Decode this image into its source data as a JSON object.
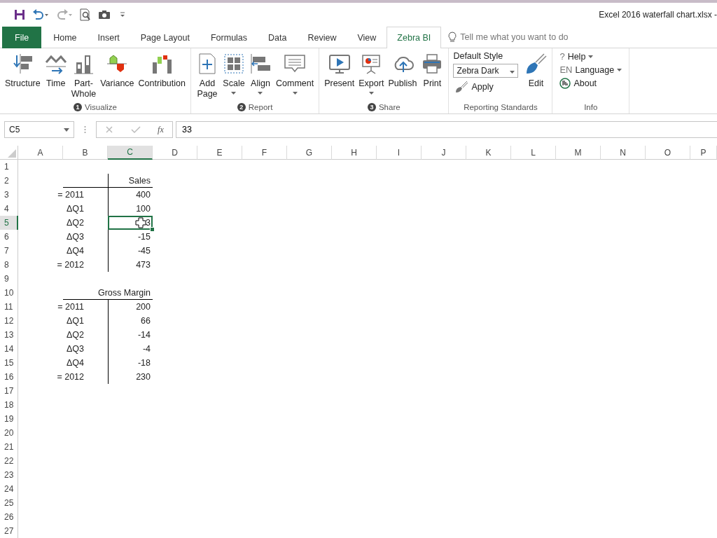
{
  "window": {
    "title": "Excel 2016 waterfall chart.xlsx -"
  },
  "tabs": [
    {
      "label": "File",
      "kind": "file",
      "selected": false
    },
    {
      "label": "Home",
      "kind": "tab",
      "selected": false
    },
    {
      "label": "Insert",
      "kind": "tab",
      "selected": false
    },
    {
      "label": "Page Layout",
      "kind": "tab",
      "selected": false
    },
    {
      "label": "Formulas",
      "kind": "tab",
      "selected": false
    },
    {
      "label": "Data",
      "kind": "tab",
      "selected": false
    },
    {
      "label": "Review",
      "kind": "tab",
      "selected": false
    },
    {
      "label": "View",
      "kind": "tab",
      "selected": false
    },
    {
      "label": "Zebra BI",
      "kind": "tab",
      "selected": true
    }
  ],
  "tell_me": {
    "placeholder": "Tell me what you want to do"
  },
  "ribbon_groups": [
    {
      "kind": "buttons",
      "number": "1",
      "label": "Visualize",
      "buttons": [
        {
          "label": "Structure",
          "dropdown": false
        },
        {
          "label": "Time",
          "dropdown": false
        },
        {
          "label": "Part-\nWhole",
          "dropdown": false
        },
        {
          "label": "Variance",
          "dropdown": false
        },
        {
          "label": "Contribution",
          "dropdown": false
        }
      ]
    },
    {
      "kind": "buttons",
      "number": "2",
      "label": "Report",
      "buttons": [
        {
          "label": "Add\nPage",
          "dropdown": false
        },
        {
          "label": "Scale",
          "dropdown": true
        },
        {
          "label": "Align",
          "dropdown": true
        },
        {
          "label": "Comment",
          "dropdown": true
        }
      ]
    },
    {
      "kind": "buttons",
      "number": "3",
      "label": "Share",
      "buttons": [
        {
          "label": "Present",
          "dropdown": false
        },
        {
          "label": "Export",
          "dropdown": true
        },
        {
          "label": "Publish",
          "dropdown": false
        },
        {
          "label": "Print",
          "dropdown": false
        }
      ]
    },
    {
      "kind": "style",
      "label": "Reporting Standards",
      "style_label": "Default Style",
      "style_value": "Zebra Dark",
      "apply": "Apply",
      "edit": "Edit"
    },
    {
      "kind": "info",
      "label": "Info",
      "items": [
        {
          "prefix": "?",
          "label": "Help",
          "dropdown": true
        },
        {
          "prefix": "EN",
          "label": "Language",
          "dropdown": true
        },
        {
          "label": "About",
          "dropdown": false
        }
      ]
    }
  ],
  "formula_bar": {
    "name_box": "C5",
    "fx": "fx",
    "value": "33"
  },
  "columns": [
    {
      "label": "A",
      "selected": false
    },
    {
      "label": "B",
      "selected": false
    },
    {
      "label": "C",
      "selected": true
    },
    {
      "label": "D",
      "selected": false
    },
    {
      "label": "E",
      "selected": false
    },
    {
      "label": "F",
      "selected": false
    },
    {
      "label": "G",
      "selected": false
    },
    {
      "label": "H",
      "selected": false
    },
    {
      "label": "I",
      "selected": false
    },
    {
      "label": "J",
      "selected": false
    },
    {
      "label": "K",
      "selected": false
    },
    {
      "label": "L",
      "selected": false
    },
    {
      "label": "M",
      "selected": false
    },
    {
      "label": "N",
      "selected": false
    },
    {
      "label": "O",
      "selected": false
    },
    {
      "label": "P",
      "selected": false
    }
  ],
  "rows": [
    {
      "label": "1",
      "selected": false
    },
    {
      "label": "2",
      "selected": false,
      "divider": true,
      "rule_below": true,
      "c": {
        "text": "Sales",
        "selected": false
      }
    },
    {
      "label": "3",
      "selected": false,
      "divider": true,
      "b": "= 2011",
      "c": {
        "text": "400",
        "selected": false
      }
    },
    {
      "label": "4",
      "selected": false,
      "divider": true,
      "b": "ΔQ1",
      "c": {
        "text": "100",
        "selected": false
      }
    },
    {
      "label": "5",
      "selected": true,
      "divider": true,
      "b": "ΔQ2",
      "c": {
        "text": "3",
        "selected": true
      }
    },
    {
      "label": "6",
      "selected": false,
      "divider": true,
      "b": "ΔQ3",
      "c": {
        "text": "-15",
        "selected": false
      }
    },
    {
      "label": "7",
      "selected": false,
      "divider": true,
      "b": "ΔQ4",
      "c": {
        "text": "-45",
        "selected": false
      }
    },
    {
      "label": "8",
      "selected": false,
      "divider": true,
      "b": "= 2012",
      "c": {
        "text": "473",
        "selected": false
      }
    },
    {
      "label": "9",
      "selected": false
    },
    {
      "label": "10",
      "selected": false,
      "rule_below": true,
      "c": {
        "text": "Gross Margin",
        "selected": false
      }
    },
    {
      "label": "11",
      "selected": false,
      "divider": true,
      "b": "= 2011",
      "c": {
        "text": "200",
        "selected": false
      }
    },
    {
      "label": "12",
      "selected": false,
      "divider": true,
      "b": "ΔQ1",
      "c": {
        "text": "66",
        "selected": false
      }
    },
    {
      "label": "13",
      "selected": false,
      "divider": true,
      "b": "ΔQ2",
      "c": {
        "text": "-14",
        "selected": false
      }
    },
    {
      "label": "14",
      "selected": false,
      "divider": true,
      "b": "ΔQ3",
      "c": {
        "text": "-4",
        "selected": false
      }
    },
    {
      "label": "15",
      "selected": false,
      "divider": true,
      "b": "ΔQ4",
      "c": {
        "text": "-18",
        "selected": false
      }
    },
    {
      "label": "16",
      "selected": false,
      "divider": true,
      "b": "= 2012",
      "c": {
        "text": "230",
        "selected": false
      }
    },
    {
      "label": "17",
      "selected": false
    },
    {
      "label": "18",
      "selected": false
    },
    {
      "label": "19",
      "selected": false
    },
    {
      "label": "20",
      "selected": false
    },
    {
      "label": "21",
      "selected": false
    },
    {
      "label": "22",
      "selected": false
    },
    {
      "label": "23",
      "selected": false
    },
    {
      "label": "24",
      "selected": false
    },
    {
      "label": "25",
      "selected": false
    },
    {
      "label": "26",
      "selected": false
    },
    {
      "label": "27",
      "selected": false
    }
  ]
}
